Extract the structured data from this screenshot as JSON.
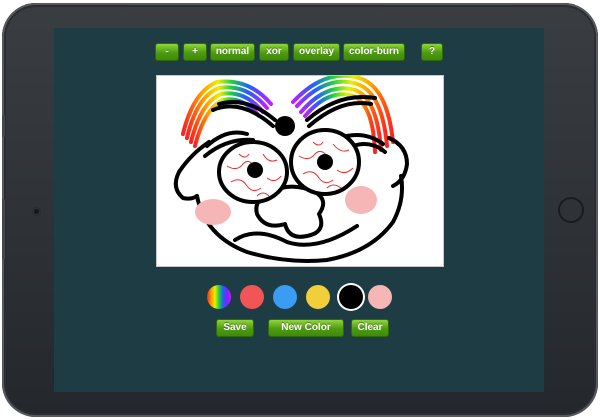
{
  "toolbar": {
    "buttons": [
      {
        "name": "zoom-out-button",
        "label": "-"
      },
      {
        "name": "zoom-in-button",
        "label": "+"
      },
      {
        "name": "blend-normal-button",
        "label": "normal"
      },
      {
        "name": "blend-xor-button",
        "label": "xor"
      },
      {
        "name": "blend-overlay-button",
        "label": "overlay"
      },
      {
        "name": "blend-color-burn-button",
        "label": "color-burn"
      },
      {
        "name": "help-button",
        "label": "?"
      }
    ]
  },
  "palette": {
    "swatches": [
      {
        "name": "swatch-rainbow",
        "color": "rainbow"
      },
      {
        "name": "swatch-red",
        "color": "#f25555"
      },
      {
        "name": "swatch-blue",
        "color": "#3a9cf2"
      },
      {
        "name": "swatch-yellow",
        "color": "#f2cf3a"
      },
      {
        "name": "swatch-black",
        "color": "#000000",
        "selected": true
      },
      {
        "name": "swatch-pink",
        "color": "#f7b6b6"
      }
    ]
  },
  "actions": {
    "save_label": "Save",
    "new_color_label": "New Color",
    "clear_label": "Clear"
  },
  "colors": {
    "screen_bg": "#1d3c44",
    "button_green": "#4d9a12",
    "ink": "#000000",
    "vein_red": "#e03030",
    "cheek_pink": "#f7b6b6"
  }
}
